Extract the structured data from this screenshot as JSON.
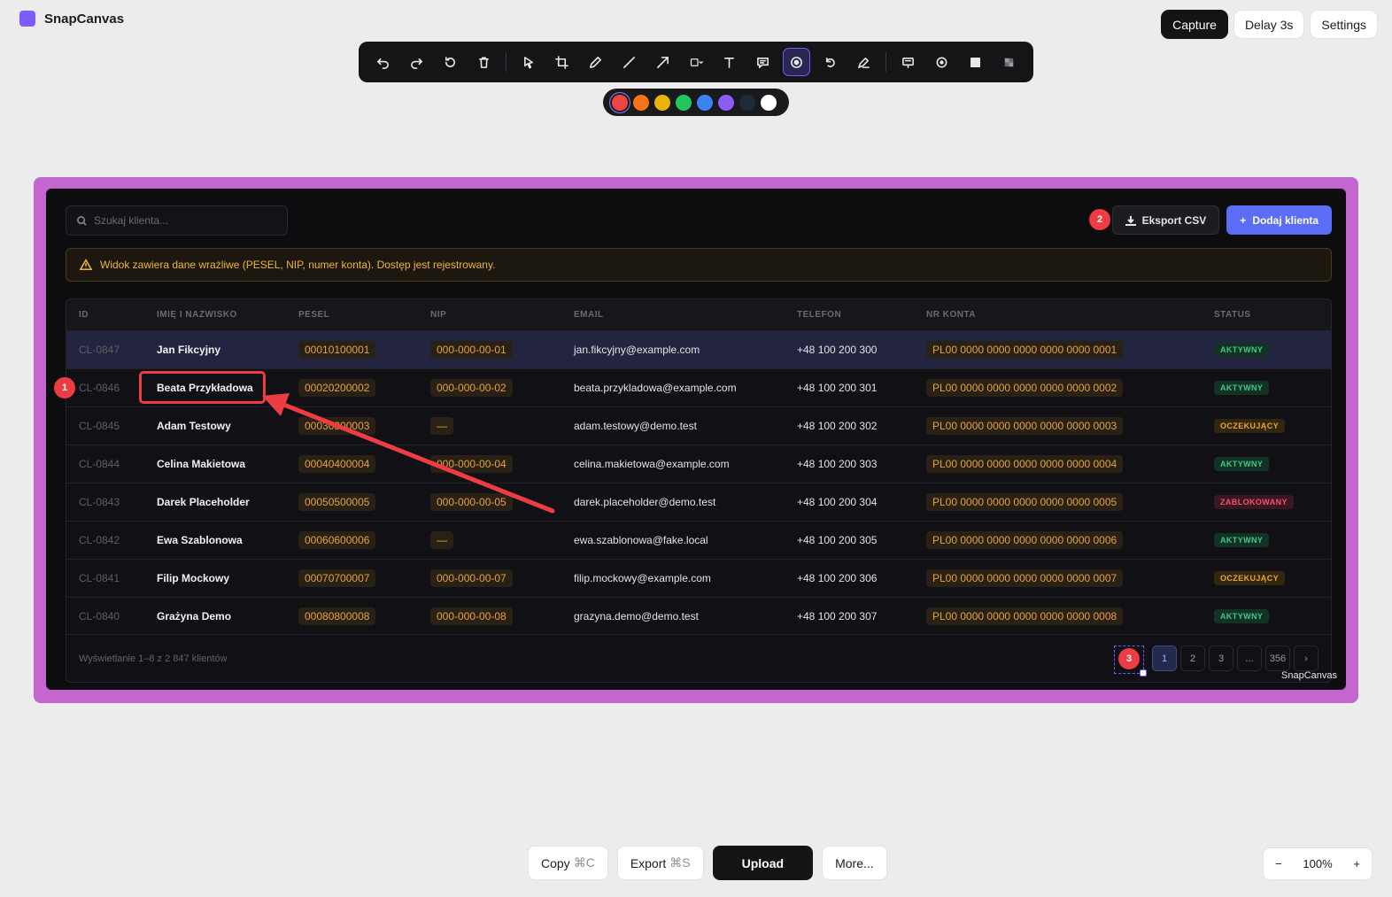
{
  "app": {
    "name": "SnapCanvas"
  },
  "top_actions": {
    "capture": "Capture",
    "delay": "Delay 3s",
    "settings": "Settings"
  },
  "toolbar": {
    "tools": [
      "undo-icon",
      "redo-icon",
      "reset-icon",
      "trash-icon",
      "pointer-icon",
      "crop-icon",
      "pen-icon",
      "line-icon",
      "arrow-icon",
      "shape-icon",
      "text-icon",
      "callout-icon",
      "step-marker-icon",
      "rotate-icon",
      "eraser-icon",
      "blur-text-icon",
      "spotlight-icon",
      "fill-icon",
      "pixelate-icon"
    ],
    "active_tool": "step-marker-icon"
  },
  "colors": [
    "#ef4444",
    "#f97316",
    "#eab308",
    "#22c55e",
    "#3b82f6",
    "#8b5cf6",
    "#1f2937",
    "#ffffff"
  ],
  "selected_color": "#ef4444",
  "canvas": {
    "frame_color": "#c466cf",
    "search": {
      "placeholder": "Szukaj klienta..."
    },
    "export_label": "Eksport CSV",
    "add_label": "Dodaj klienta",
    "add_prefix": "+",
    "warning": "Widok zawiera dane wrażliwe (PESEL, NIP, numer konta). Dostęp jest rejestrowany.",
    "columns": [
      "ID",
      "IMIĘ I NAZWISKO",
      "PESEL",
      "NIP",
      "EMAIL",
      "TELEFON",
      "NR KONTA",
      "STATUS"
    ],
    "rows": [
      {
        "id": "CL-0847",
        "name": "Jan Fikcyjny",
        "pesel": "00010100001",
        "nip": "000-000-00-01",
        "email": "jan.fikcyjny@example.com",
        "phone": "+48 100 200 300",
        "account": "PL00 0000 0000 0000 0000 0000 0001",
        "status": "AKTYWNY",
        "status_type": "active"
      },
      {
        "id": "CL-0846",
        "name": "Beata Przykładowa",
        "pesel": "00020200002",
        "nip": "000-000-00-02",
        "email": "beata.przykladowa@example.com",
        "phone": "+48 100 200 301",
        "account": "PL00 0000 0000 0000 0000 0000 0002",
        "status": "AKTYWNY",
        "status_type": "active"
      },
      {
        "id": "CL-0845",
        "name": "Adam Testowy",
        "pesel": "00030300003",
        "nip": "—",
        "email": "adam.testowy@demo.test",
        "phone": "+48 100 200 302",
        "account": "PL00 0000 0000 0000 0000 0000 0003",
        "status": "OCZEKUJĄCY",
        "status_type": "pending"
      },
      {
        "id": "CL-0844",
        "name": "Celina Makietowa",
        "pesel": "00040400004",
        "nip": "000-000-00-04",
        "email": "celina.makietowa@example.com",
        "phone": "+48 100 200 303",
        "account": "PL00 0000 0000 0000 0000 0000 0004",
        "status": "AKTYWNY",
        "status_type": "active"
      },
      {
        "id": "CL-0843",
        "name": "Darek Placeholder",
        "pesel": "00050500005",
        "nip": "000-000-00-05",
        "email": "darek.placeholder@demo.test",
        "phone": "+48 100 200 304",
        "account": "PL00 0000 0000 0000 0000 0000 0005",
        "status": "ZABLOKOWANY",
        "status_type": "blocked"
      },
      {
        "id": "CL-0842",
        "name": "Ewa Szablonowa",
        "pesel": "00060600006",
        "nip": "—",
        "email": "ewa.szablonowa@fake.local",
        "phone": "+48 100 200 305",
        "account": "PL00 0000 0000 0000 0000 0000 0006",
        "status": "AKTYWNY",
        "status_type": "active"
      },
      {
        "id": "CL-0841",
        "name": "Filip Mockowy",
        "pesel": "00070700007",
        "nip": "000-000-00-07",
        "email": "filip.mockowy@example.com",
        "phone": "+48 100 200 306",
        "account": "PL00 0000 0000 0000 0000 0000 0007",
        "status": "OCZEKUJĄCY",
        "status_type": "pending"
      },
      {
        "id": "CL-0840",
        "name": "Grażyna Demo",
        "pesel": "00080800008",
        "nip": "000-000-00-08",
        "email": "grazyna.demo@demo.test",
        "phone": "+48 100 200 307",
        "account": "PL00 0000 0000 0000 0000 0000 0008",
        "status": "AKTYWNY",
        "status_type": "active"
      }
    ],
    "footer_text": "Wyświetlanie 1–8 z 2 847 klientów",
    "pages": [
      "1",
      "2",
      "3",
      "...",
      "356",
      "›"
    ],
    "current_page": "1",
    "watermark": "SnapCanvas"
  },
  "annotations": {
    "marker_1": "1",
    "marker_2": "2",
    "marker_3": "3"
  },
  "bottom": {
    "copy": "Copy",
    "copy_kbd": "⌘C",
    "export": "Export",
    "export_kbd": "⌘S",
    "upload": "Upload",
    "more": "More..."
  },
  "zoom": {
    "minus": "−",
    "value": "100%",
    "plus": "+"
  }
}
